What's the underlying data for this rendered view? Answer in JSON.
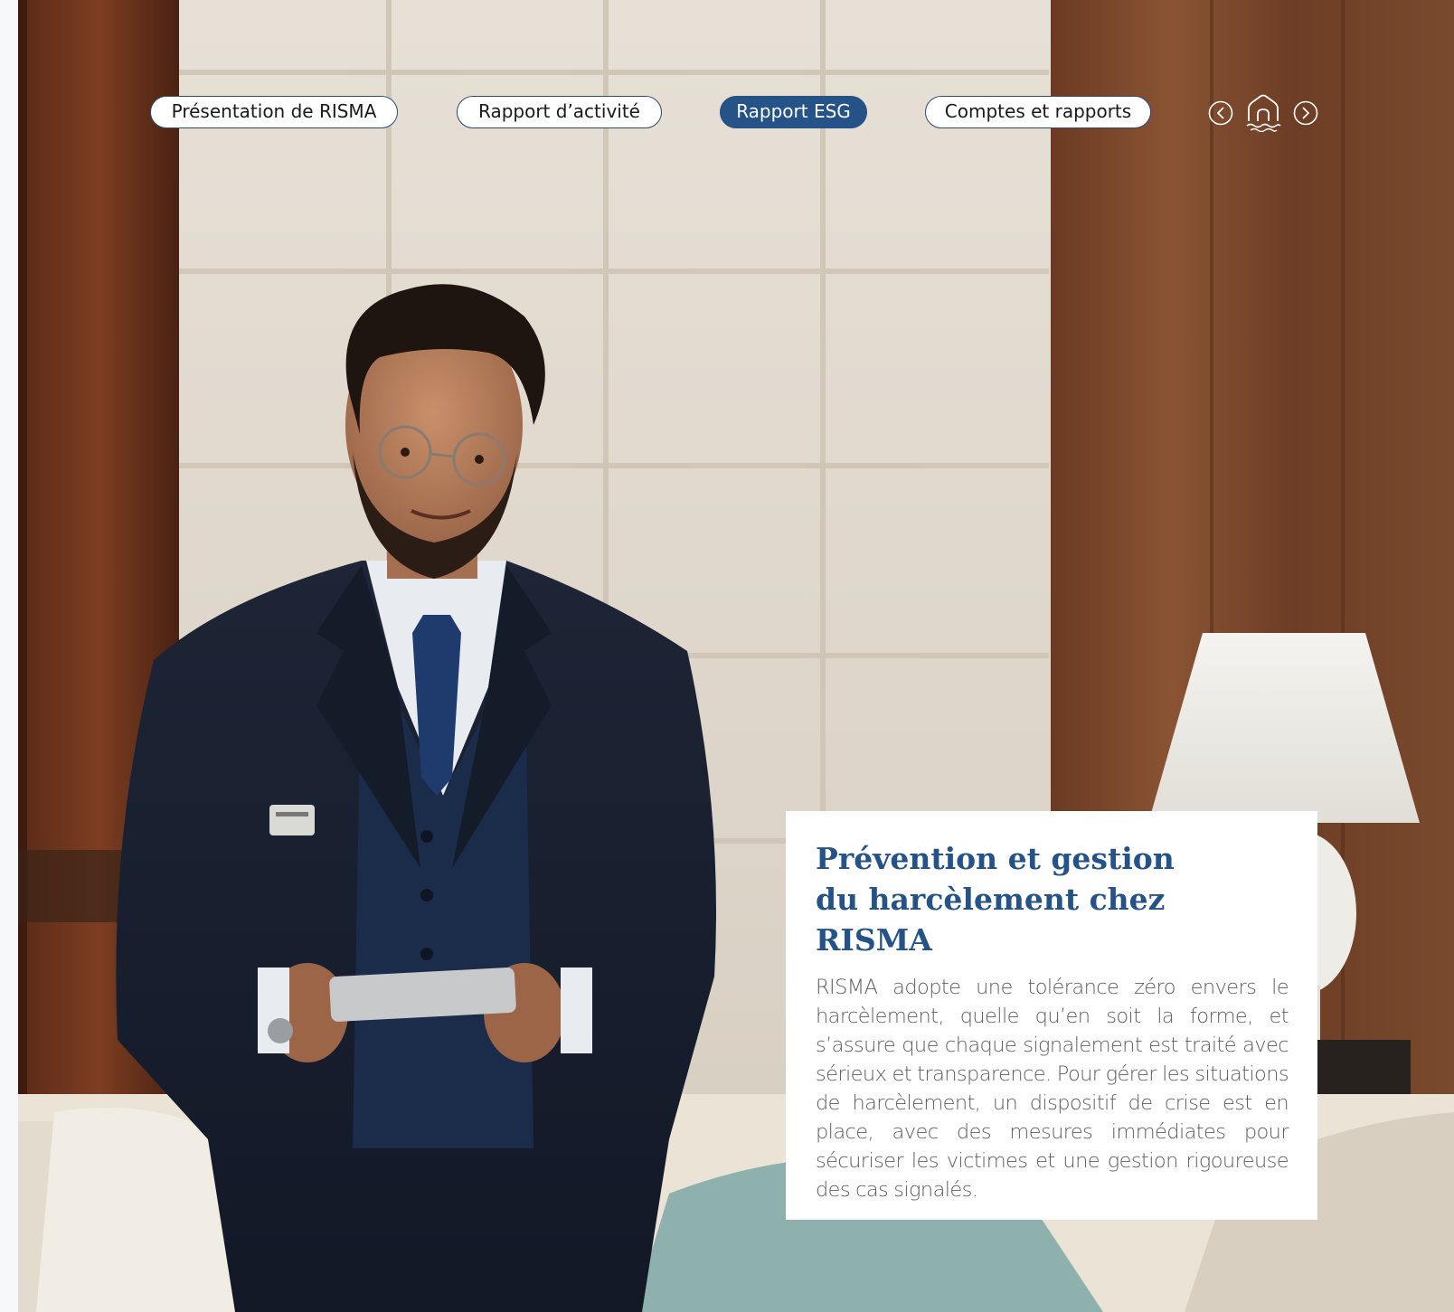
{
  "nav": {
    "items": [
      {
        "label": "Présentation de RISMA",
        "active": false
      },
      {
        "label": "Rapport d’activité",
        "active": false
      },
      {
        "label": "Rapport ESG",
        "active": true
      },
      {
        "label": "Comptes et rapports",
        "active": false
      }
    ],
    "icons": [
      "chevron-left-icon",
      "home-icon",
      "chevron-right-icon"
    ]
  },
  "card": {
    "title_line1": "Prévention et gestion",
    "title_line2": "du harcèlement chez RISMA",
    "body": "RISMA adopte une tolérance zéro envers le harcèlement, quelle qu’en soit la forme, et s’assure que chaque signalement est traité avec sérieux et transparence. Pour gérer les situations de harcèlement, un dispositif de crise est en place, avec des mesures immédiates pour sécuriser les victimes et une gestion rigoureuse des cas signalés."
  },
  "colors": {
    "accent": "#255287",
    "pill_border": "#2d4a74",
    "body_text": "#5f5f5f"
  },
  "photo": {
    "subject": "hotel-concierge-photo"
  }
}
